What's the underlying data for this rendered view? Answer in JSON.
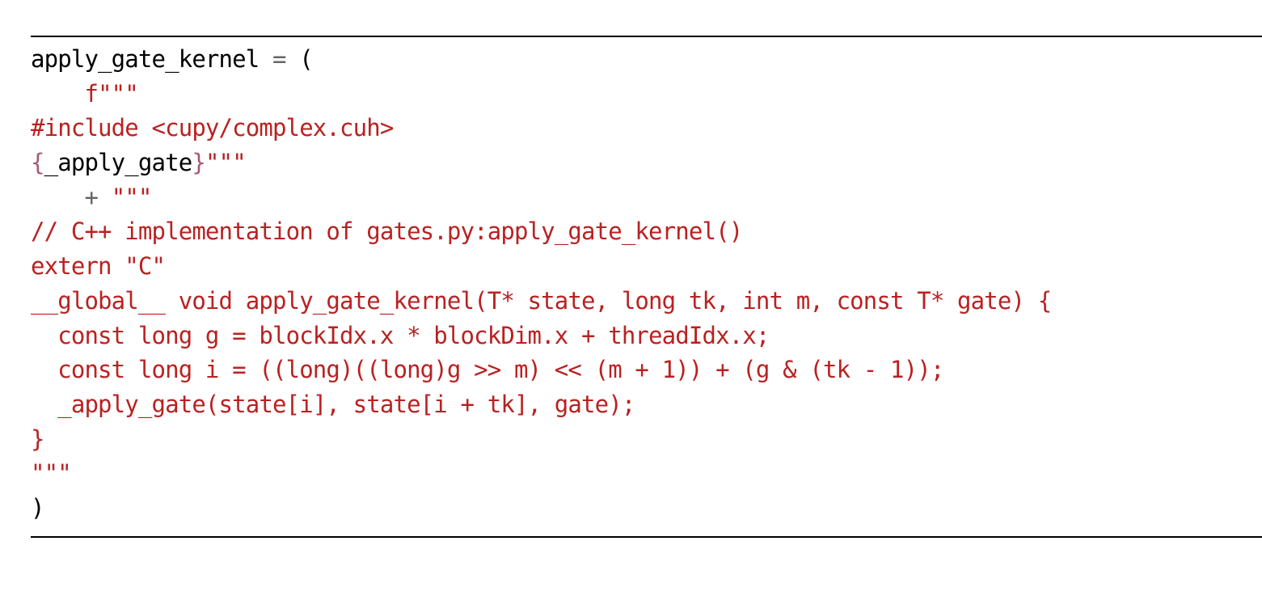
{
  "colors": {
    "text": "#000000",
    "string": "#ba2121",
    "interpolation": "#a45a77",
    "operator": "#666666"
  },
  "code": {
    "line1": {
      "name": "apply_gate_kernel",
      "eq": "=",
      "paren": "("
    },
    "line2": {
      "indent": "    ",
      "fstring_open": "f\"\"\""
    },
    "line3": {
      "text": "#include <cupy/complex.cuh>"
    },
    "line4": {
      "brace_open": "{",
      "var": "_apply_gate",
      "brace_close": "}",
      "quotes": "\"\"\""
    },
    "line5": {
      "indent": "    ",
      "plus": "+",
      "quotes": "\"\"\""
    },
    "line6": {
      "text": "// C++ implementation of gates.py:apply_gate_kernel()"
    },
    "line7": {
      "text": "extern \"C\""
    },
    "line8": {
      "text": "__global__ void apply_gate_kernel(T* state, long tk, int m, const T* gate) {"
    },
    "line9": {
      "text": "  const long g = blockIdx.x * blockDim.x + threadIdx.x;"
    },
    "line10": {
      "text": "  const long i = ((long)((long)g >> m) << (m + 1)) + (g & (tk - 1));"
    },
    "line11": {
      "text": "  _apply_gate(state[i], state[i + tk], gate);"
    },
    "line12": {
      "text": "}"
    },
    "line13": {
      "text": "\"\"\""
    },
    "line14": {
      "text": ")"
    }
  }
}
